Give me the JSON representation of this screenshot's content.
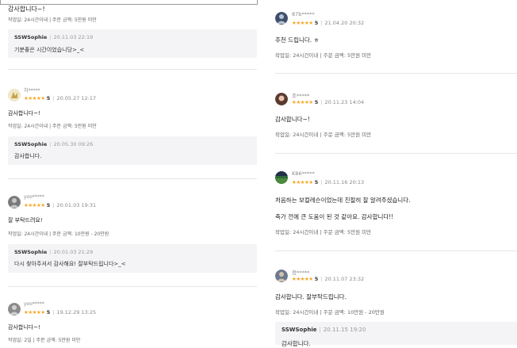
{
  "left_reviews": [
    {
      "review_text": "감사합니다~!",
      "info": "작업일: 24시간이내 | 주문 금액: 5만원 미만",
      "reply": {
        "seller": "SSWSophie",
        "date": "20.11.03 22:19",
        "text": "기분좋은 시간이었습니당>_<"
      }
    },
    {
      "user": "치*****",
      "stars": "★★★★★",
      "score": "5",
      "date": "20.05.27 12:17",
      "review_text": "감사합니다~!",
      "info": "작업일: 24시간이내 | 주문 금액: 5만원 미만",
      "reply": {
        "seller": "SSWSophie",
        "date": "20.05.30 09:26",
        "text": "감사합니다."
      }
    },
    {
      "user": "yoo*****",
      "stars": "★★★★★",
      "score": "5",
      "date": "20.01.03 19:31",
      "review_text": "잘 부탁드려요!",
      "info": "작업일: 24시간이내 | 주문 금액: 10만원 - 20만원",
      "reply": {
        "seller": "SSWSophie",
        "date": "20.01.03 21:29",
        "text": "다시 찾아주셔서 감사해요! 잘부탁드립니다>_<"
      }
    },
    {
      "user": "yoo*****",
      "stars": "★★★★★",
      "score": "5",
      "date": "19.12.29 13:25",
      "review_text": "감사합니다~!",
      "info": "작업일: 2일 | 주문 금액: 5만원 미만"
    }
  ],
  "right_reviews": [
    {
      "user": "87b*****",
      "stars": "★★★★★",
      "score": "5",
      "date": "21.04.20 20:32",
      "review_text": "추천 드립니다. ㅎ",
      "info": "작업일: 24시간이내 | 주문 금액: 5만원 미만"
    },
    {
      "user": "조*****",
      "stars": "★★★★★",
      "score": "5",
      "date": "20.11.23 14:04",
      "review_text": "감사합니다~!",
      "info": "작업일: 24시간이내 | 주문 금액: 5만원 미만"
    },
    {
      "user": "K86*****",
      "stars": "★★★★★",
      "score": "5",
      "date": "20.11.16 20:13",
      "review_text_1": "처음하는 보컬레슨이었는데 친절히 잘 알려주셨습니다.",
      "review_text_2": "축가 전에 큰 도움이 된 것 같아요. 감사합니다!!",
      "info": "작업일: 24시간이내 | 주문 금액: 5만원 미만"
    },
    {
      "user": "정*****",
      "stars": "★★★★★",
      "score": "5",
      "date": "20.11.07 23:32",
      "review_text": "감사합니다. 잘부탁드립니다.",
      "info": "작업일: 24시간이내 | 주문 금액: 10만원 - 20만원",
      "reply": {
        "seller": "SSWSophie",
        "date": "20.11.15 19:20",
        "text": "감사합니다."
      }
    }
  ],
  "colors": {
    "star": "#f5a623",
    "reply_bg": "#f4f4f6",
    "separator": "#e6e6e6"
  }
}
